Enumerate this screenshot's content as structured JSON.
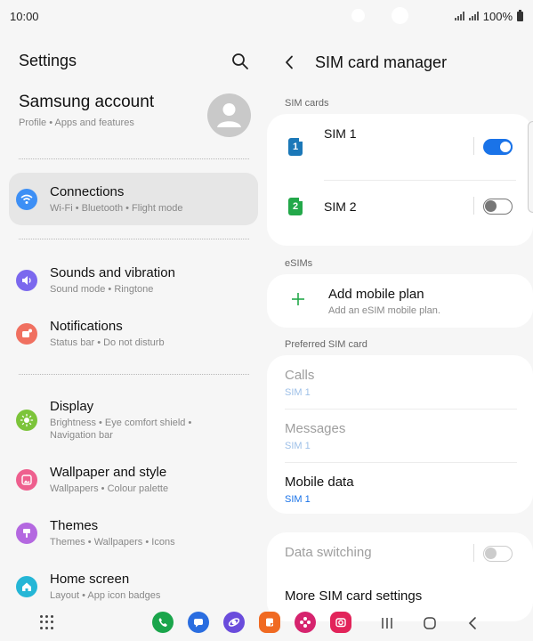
{
  "status": {
    "time": "10:00",
    "battery": "100%"
  },
  "left": {
    "title": "Settings",
    "account": {
      "name": "Samsung account",
      "sub": "Profile  •  Apps and features"
    },
    "items": [
      {
        "title": "Connections",
        "sub": "Wi-Fi  •  Bluetooth  •  Flight mode",
        "icon": "wifi-icon",
        "color": "#3d8ff5"
      },
      {
        "title": "Sounds and vibration",
        "sub": "Sound mode  •  Ringtone",
        "icon": "speaker-icon",
        "color": "#7b68ee"
      },
      {
        "title": "Notifications",
        "sub": "Status bar  •  Do not disturb",
        "icon": "notification-icon",
        "color": "#f07060"
      },
      {
        "title": "Display",
        "sub": "Brightness  •  Eye comfort shield  •  Navigation bar",
        "icon": "sun-icon",
        "color": "#7cc43a"
      },
      {
        "title": "Wallpaper and style",
        "sub": "Wallpapers  •  Colour palette",
        "icon": "image-icon",
        "color": "#ee5f8e"
      },
      {
        "title": "Themes",
        "sub": "Themes  •  Wallpapers  •  Icons",
        "icon": "brush-icon",
        "color": "#b468e0"
      },
      {
        "title": "Home screen",
        "sub": "Layout  •  App icon badges",
        "icon": "home-icon",
        "color": "#25b6d6"
      }
    ]
  },
  "right": {
    "title": "SIM card manager",
    "sim_cards_label": "SIM cards",
    "sims": [
      {
        "badge": "1",
        "name": "SIM 1",
        "badge_color": "#1b78b8",
        "enabled": true
      },
      {
        "badge": "2",
        "name": "SIM 2",
        "badge_color": "#23a84a",
        "enabled": false
      }
    ],
    "esims_label": "eSIMs",
    "esim": {
      "title": "Add mobile plan",
      "sub": "Add an eSIM mobile plan."
    },
    "preferred_label": "Preferred SIM card",
    "preferred": [
      {
        "title": "Calls",
        "value": "SIM 1",
        "enabled": false
      },
      {
        "title": "Messages",
        "value": "SIM 1",
        "enabled": false
      },
      {
        "title": "Mobile data",
        "value": "SIM 1",
        "enabled": true
      }
    ],
    "data_switching": "Data switching",
    "more_settings": "More SIM card settings"
  },
  "dock": [
    {
      "name": "phone-app-icon",
      "color": "#1aa54b"
    },
    {
      "name": "messages-app-icon",
      "color": "#2a6de0"
    },
    {
      "name": "internet-app-icon",
      "color": "#6a4cdc"
    },
    {
      "name": "notes-app-icon",
      "color": "#f06a22"
    },
    {
      "name": "gallery-app-icon",
      "color": "#d6246e"
    },
    {
      "name": "camera-app-icon",
      "color": "#e2245a"
    }
  ]
}
